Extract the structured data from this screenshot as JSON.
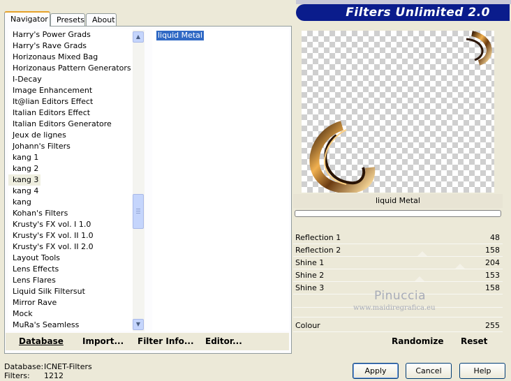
{
  "banner": {
    "title": "Filters Unlimited 2.0"
  },
  "tabs": [
    {
      "label": "Navigator"
    },
    {
      "label": "Presets"
    },
    {
      "label": "About"
    }
  ],
  "filter_list": {
    "items": [
      "Harry's Power Grads",
      "Harry's Rave Grads",
      "Horizonaus Mixed Bag",
      "Horizonaus Pattern Generators",
      "I-Decay",
      "Image Enhancement",
      "It@lian Editors Effect",
      "Italian Editors Effect",
      "Italian Editors Generatore",
      "Jeux de lignes",
      "Johann's Filters",
      "kang 1",
      "kang 2",
      "kang 3",
      "kang 4",
      "kang",
      "Kohan's Filters",
      "Krusty's FX vol. I 1.0",
      "Krusty's FX vol. II 1.0",
      "Krusty's FX vol. II 2.0",
      "Layout Tools",
      "Lens Effects",
      "Lens Flares",
      "Liquid Silk Filtersut",
      "Mirror Rave",
      "Mock",
      "MuRa's Seamless"
    ],
    "selected": "kang 3"
  },
  "effects_list": {
    "items": [
      "liquid Metal"
    ],
    "selected": "liquid Metal"
  },
  "toolbar": {
    "database": "Database",
    "import": "Import...",
    "filter_info": "Filter Info...",
    "editor": "Editor..."
  },
  "preview": {
    "filter_name": "liquid Metal"
  },
  "params": [
    {
      "label": "Reflection 1",
      "value": "48"
    },
    {
      "label": "Reflection 2",
      "value": "158"
    },
    {
      "label": "Shine 1",
      "value": "204"
    },
    {
      "label": "Shine 2",
      "value": "153"
    },
    {
      "label": "Shine 3",
      "value": "158"
    },
    {
      "label": "Colour",
      "value": "255"
    }
  ],
  "right_buttons": {
    "randomize": "Randomize",
    "reset": "Reset"
  },
  "watermark": {
    "name": "Pinuccia",
    "url": "www.maidiregrafica.eu"
  },
  "status": {
    "database_label": "Database:",
    "database_value": "ICNET-Filters",
    "filters_label": "Filters:",
    "filters_value": "1212"
  },
  "dialog_buttons": {
    "apply": "Apply",
    "cancel": "Cancel",
    "help": "Help"
  },
  "colors": {
    "banner": "#0a1c8c",
    "selection": "#316ac5",
    "tab_accent": "#e6a22a"
  },
  "icons": {
    "scroll_up": "chevron-up-icon",
    "scroll_down": "chevron-down-icon"
  }
}
